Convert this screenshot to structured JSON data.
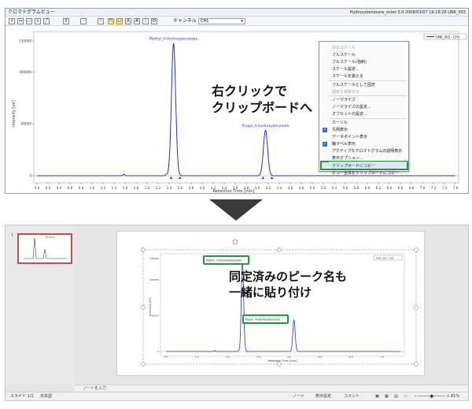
{
  "window": {
    "title": "クロマトグラムビュー",
    "right_title": "Hydroxybenzoate_ester-3.d 2008/03/07 19:18:26 UNK_003",
    "channel_label": "チャンネル",
    "channel_value": "CH1",
    "toolbar_icons": [
      "zoom-icon",
      "pan-icon",
      "select-icon",
      "peak-icon",
      "line-icon",
      "tool-icon",
      "tool-icon",
      "tool-icon",
      "tool-icon",
      "tool-icon"
    ]
  },
  "chart_data": {
    "type": "line",
    "title": "",
    "xlabel": "Retention Time [min]",
    "ylabel": "Intensity [uV]",
    "xlim": [
      0.0,
      7.6
    ],
    "ylim": [
      -2000,
      135000
    ],
    "x_ticks": [
      "0.0",
      "0.2",
      "0.4",
      "0.6",
      "0.8",
      "1.0",
      "1.2",
      "1.4",
      "1.6",
      "1.8",
      "2.0",
      "2.2",
      "2.4",
      "2.6",
      "2.8",
      "3.0",
      "3.2",
      "3.4",
      "3.6",
      "3.8",
      "4.0",
      "4.2",
      "4.4",
      "4.6",
      "4.8",
      "5.0",
      "5.2",
      "5.4",
      "5.6",
      "5.8",
      "6.0",
      "6.2",
      "6.4",
      "6.6",
      "6.8",
      "7.0",
      "7.2",
      "7.4",
      "7.6"
    ],
    "y_ticks": [
      "0",
      "50000",
      "100000",
      "130000"
    ],
    "legend": "UNK_003 - CH1",
    "peaks": [
      {
        "name": "Methyl_4-Hydroxybenzoate",
        "x": 2.48,
        "y": 128000
      },
      {
        "name": "Propyl_4-Hydroxybenzoate",
        "x": 4.15,
        "y": 44000
      }
    ],
    "small_peaks": [
      {
        "x": 1.58,
        "y": 1500
      },
      {
        "x": 2.35,
        "y": 1200
      }
    ]
  },
  "context_menu": {
    "items": [
      {
        "label": "前のスケール",
        "disabled": true
      },
      {
        "label": "フルスケール",
        "disabled": false
      },
      {
        "label": "フルスケール(強制)",
        "disabled": false
      },
      {
        "label": "スケール設定...",
        "disabled": false
      },
      {
        "label": "スケールを揃える",
        "disabled": false
      },
      {
        "label": "フルスケールとして固定",
        "disabled": false
      },
      {
        "label": "固定を解除する",
        "disabled": true
      },
      {
        "label": "ノーマライズ",
        "disabled": false
      },
      {
        "label": "ノーマライズの設定...",
        "disabled": false
      },
      {
        "label": "オフセットの設定...",
        "disabled": false
      },
      {
        "label": "カーソル",
        "disabled": false
      },
      {
        "label": "凡例表示",
        "disabled": false,
        "checked": true
      },
      {
        "label": "データポイント表示",
        "disabled": false
      },
      {
        "label": "軸ラベル表示",
        "disabled": false,
        "checked": true
      },
      {
        "label": "アクティブなクロマトグラムの説明表示",
        "disabled": false
      },
      {
        "label": "表示オプション...",
        "disabled": false
      },
      {
        "label": "クリップボードにコピー",
        "disabled": false
      },
      {
        "label": "ビュー全体をクリップボードにコピー",
        "disabled": false
      }
    ]
  },
  "callout_top": {
    "line1": "右クリックで",
    "line2": "クリップボードへ"
  },
  "callout_bottom": {
    "line1": "同定済みのピーク名も",
    "line2": "一緒に貼り付け"
  },
  "app": {
    "thumb_number": "1",
    "thumb_title": "Hchrom",
    "notes_placeholder": "ノートを入力",
    "status_slide": "スライド 1/1",
    "status_lang": "日本語",
    "status_notes": "ノート",
    "status_display": "表示設定",
    "status_comments": "コメント",
    "zoom": "81%"
  },
  "slide_chart": {
    "y_ticks": [
      "0",
      "50000",
      "100000",
      "130000"
    ],
    "x_ticks": [
      "0.0",
      "1.0",
      "2.0",
      "3.0",
      "4.0",
      "5.0",
      "6.0",
      "7.0"
    ],
    "xlabel": "Retention Time [min]",
    "ylabel": "Intensity [uV]",
    "legend": "UNK_003 - CH1",
    "peak1_label": "Methyl_4-Hydroxybenzoate",
    "peak2_label": "Propyl_4-Hydroxybenzoate"
  }
}
